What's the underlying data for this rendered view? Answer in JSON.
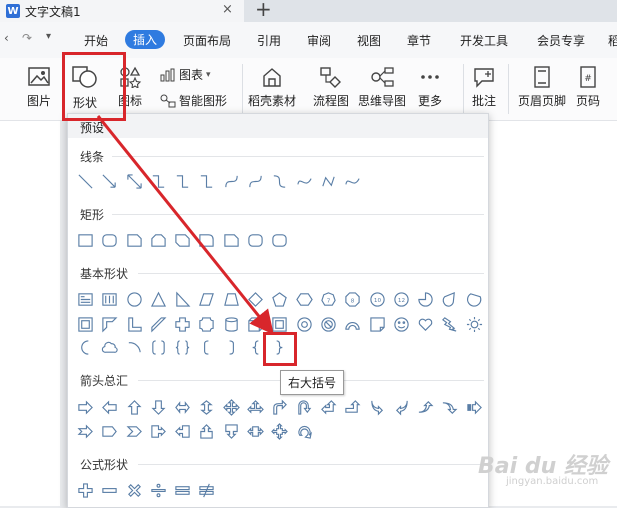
{
  "window": {
    "tab_title": "文字文稿1",
    "tab_close": "×",
    "new_tab": "+",
    "logo": "W"
  },
  "menu": {
    "items": [
      "开始",
      "插入",
      "页面布局",
      "引用",
      "审阅",
      "视图",
      "章节",
      "开发工具",
      "会员专享",
      "稻"
    ],
    "active": "插入"
  },
  "ribbon": {
    "picture": "图片",
    "shape": "形状",
    "icon": "图标",
    "chart": "图表",
    "smart_shape": "智能图形",
    "material": "稻壳素材",
    "flowchart": "流程图",
    "mindmap": "思维导图",
    "more": "更多",
    "comment": "批注",
    "header_footer": "页眉页脚",
    "page_number": "页码"
  },
  "panel": {
    "preset": "预设",
    "sections": {
      "lines": "线条",
      "rect": "矩形",
      "basic": "基本形状",
      "arrows": "箭头总汇",
      "formula": "公式形状"
    },
    "tooltip": "右大括号"
  },
  "colors": {
    "accent": "#2f7be0",
    "highlight": "#d8262b",
    "icon_stroke": "#5a7ea6"
  },
  "watermark": {
    "brand": "Bai du 经验",
    "sub": "jingyan.baidu.com"
  }
}
